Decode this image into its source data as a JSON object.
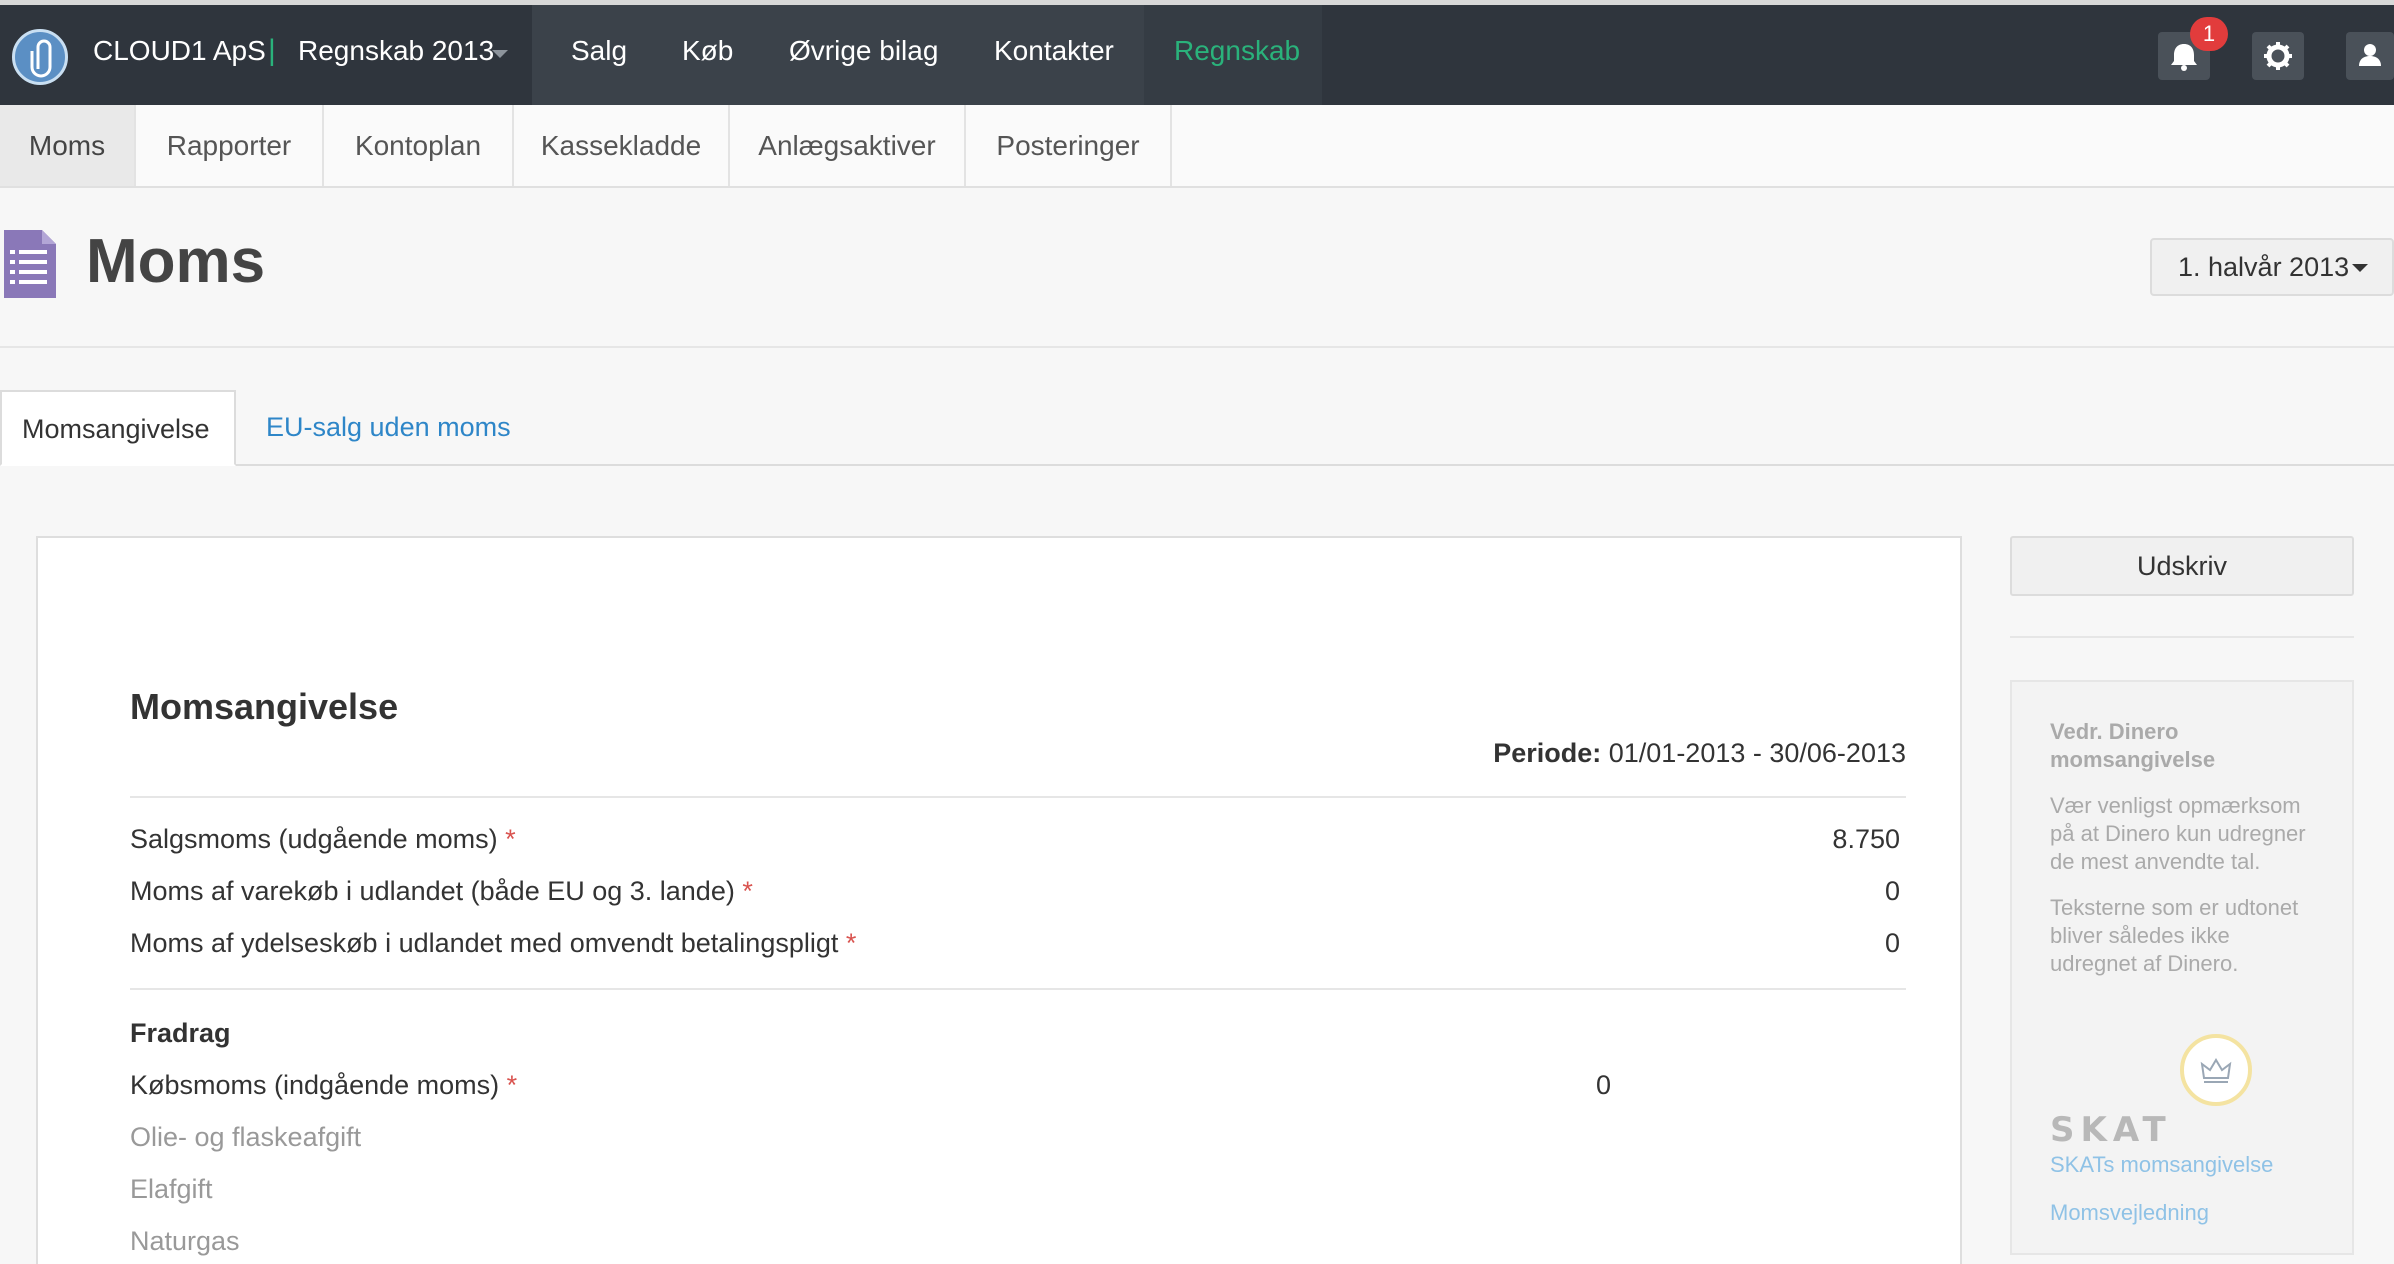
{
  "topbar": {
    "company": "CLOUD1 ApS",
    "separator": "|",
    "fiscal_year": "Regnskab 2013",
    "nav": [
      "Salg",
      "Køb",
      "Øvrige bilag",
      "Kontakter",
      "Regnskab"
    ],
    "active_nav": "Regnskab",
    "notifications_count": "1",
    "accent_color": "#2ab27b"
  },
  "subnav": {
    "tabs": [
      "Moms",
      "Rapporter",
      "Kontoplan",
      "Kassekladde",
      "Anlægsaktiver",
      "Posteringer"
    ],
    "active": "Moms"
  },
  "page": {
    "title": "Moms",
    "period_selector": "1. halvår 2013"
  },
  "tabs": {
    "active": "Momsangivelse",
    "other": "EU-salg uden moms"
  },
  "report": {
    "title": "Momsangivelse",
    "period_label": "Periode:",
    "period_value": "01/01-2013 - 30/06-2013",
    "rows": [
      {
        "label": "Salgsmoms (udgående moms)",
        "req": "*",
        "value": "8.750"
      },
      {
        "label": "Moms af varekøb i udlandet (både EU og 3. lande)",
        "req": "*",
        "value": "0"
      },
      {
        "label": "Moms af ydelseskøb i udlandet med omvendt betalingspligt",
        "req": "*",
        "value": "0"
      }
    ],
    "fradrag_title": "Fradrag",
    "fradrag_rows": [
      {
        "label": "Købsmoms (indgående moms)",
        "req": "*",
        "value": "0"
      },
      {
        "label": "Olie- og flaskeafgift"
      },
      {
        "label": "Elafgift"
      },
      {
        "label": "Naturgas"
      }
    ]
  },
  "sidebar": {
    "print_button": "Udskriv",
    "info_title": "Vedr. Dinero momsangivelse",
    "info_text_1": "Vær venligst opmærksom på at Dinero kun udregner de mest anvendte tal.",
    "info_text_2": "Teksterne som er udtonet bliver således ikke udregnet af Dinero.",
    "skat_logo": "SKAT",
    "link_1": "SKATs momsangivelse",
    "link_2": "Momsvejledning"
  }
}
